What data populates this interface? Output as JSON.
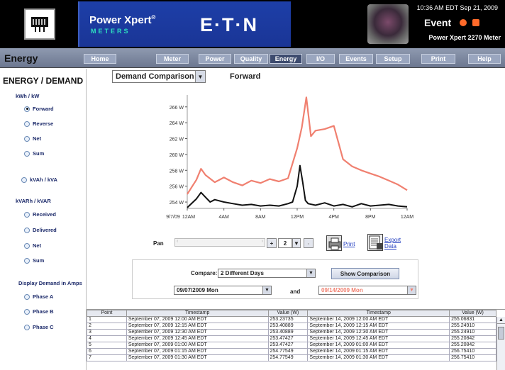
{
  "header": {
    "brand_title": "Power Xpert",
    "brand_reg": "®",
    "brand_sub": "METERS",
    "company": "E·T·N",
    "clock": "10:36 AM EDT  Sep 21, 2009",
    "event_label": "Event",
    "meter_name": "Power Xpert 2270 Meter"
  },
  "nav": {
    "section_title": "Energy",
    "tabs": [
      "Home",
      "Meter",
      "Power",
      "Quality",
      "Energy",
      "I/O",
      "Events",
      "Setup",
      "Print",
      "Help"
    ],
    "active_tab": "Energy"
  },
  "sidebar": {
    "title": "ENERGY / DEMAND",
    "kwh_label": "kWh / kW",
    "kwh_options": [
      "Forward",
      "Reverse",
      "Net",
      "Sum"
    ],
    "kwh_selected": "Forward",
    "kvah_option": "kVAh / kVA",
    "kvarh_label": "kVARh / kVAR",
    "kvarh_options": [
      "Received",
      "Delivered",
      "Net",
      "Sum"
    ],
    "amps_label": "Display Demand in Amps",
    "amps_options": [
      "Phase A",
      "Phase B",
      "Phase C"
    ]
  },
  "main": {
    "dropdown_value": "Demand Comparison",
    "direction": "Forward",
    "pan_label": "Pan",
    "zoom_value": "2",
    "print_label": "Print",
    "export_label_1": "Export",
    "export_label_2": "Data",
    "compare_label": "Compare:",
    "compare_value": "2 Different Days",
    "show_button": "Show Comparison",
    "day1_value": "09/07/2009 Mon",
    "and_label": "and",
    "day2_value": "09/14/2009 Mon"
  },
  "colors": {
    "series1": "#111111",
    "series2": "#f08070",
    "header_bg": "#000000",
    "brand_bg": "#1d3fa8",
    "nav_bg": "#7d88a1"
  },
  "chart_data": {
    "type": "line",
    "y_tick_labels": [
      "254 W",
      "256 W",
      "258 W",
      "260 W",
      "262 W",
      "264 W",
      "266 W"
    ],
    "ylim": [
      253.2,
      267.5
    ],
    "x_tick_labels": [
      "9/7/09\n12AM",
      "4AM",
      "8AM",
      "12PM",
      "4PM",
      "8PM",
      "12AM"
    ],
    "x_hours": [
      0,
      4,
      8,
      12,
      16,
      20,
      24
    ],
    "series": [
      {
        "color": "#111111",
        "x": [
          0,
          1,
          1.5,
          2,
          2.5,
          3,
          4,
          5,
          6,
          7,
          8,
          9,
          10,
          11,
          11.5,
          12,
          12.3,
          12.6,
          12.9,
          13.2,
          14,
          15,
          16,
          17,
          18,
          19,
          20,
          21,
          22,
          23,
          24
        ],
        "y": [
          253.3,
          254.4,
          255.2,
          254.6,
          254.0,
          254.3,
          254.0,
          253.8,
          253.6,
          253.7,
          253.5,
          253.6,
          253.5,
          253.8,
          254.0,
          256.0,
          258.6,
          256.5,
          254.2,
          253.8,
          253.6,
          253.9,
          253.5,
          253.7,
          253.4,
          253.8,
          253.5,
          253.6,
          253.7,
          253.5,
          253.4
        ]
      },
      {
        "color": "#f08070",
        "x": [
          0,
          1,
          1.5,
          2,
          3,
          4,
          5,
          6,
          7,
          8,
          9,
          10,
          11,
          12,
          12.5,
          13,
          13.5,
          14,
          15,
          16,
          17,
          18,
          19,
          20,
          21,
          22,
          23,
          24
        ],
        "y": [
          255.0,
          256.8,
          258.2,
          257.4,
          256.5,
          257.1,
          256.5,
          256.1,
          256.7,
          256.4,
          256.9,
          256.6,
          257.0,
          260.8,
          263.4,
          267.2,
          262.3,
          263.0,
          263.2,
          263.6,
          259.4,
          258.5,
          258.0,
          257.6,
          257.2,
          256.7,
          256.2,
          255.5
        ]
      }
    ]
  },
  "table": {
    "headers": [
      "Point",
      "Timestamp",
      "Value (W)",
      "Timestamp",
      "Value (W)"
    ],
    "rows": [
      [
        "1",
        "September 07, 2009 12:00 AM EDT",
        "253.23735",
        "September 14, 2009 12:00 AM EDT",
        "255.06831"
      ],
      [
        "2",
        "September 07, 2009 12:15 AM EDT",
        "253.40889",
        "September 14, 2009 12:15 AM EDT",
        "255.24910"
      ],
      [
        "3",
        "September 07, 2009 12:30 AM EDT",
        "253.40889",
        "September 14, 2009 12:30 AM EDT",
        "255.24910"
      ],
      [
        "4",
        "September 07, 2009 12:45 AM EDT",
        "253.47427",
        "September 14, 2009 12:45 AM EDT",
        "255.20842"
      ],
      [
        "5",
        "September 07, 2009 01:00 AM EDT",
        "253.47427",
        "September 14, 2009 01:00 AM EDT",
        "255.20842"
      ],
      [
        "6",
        "September 07, 2009 01:15 AM EDT",
        "254.77549",
        "September 14, 2009 01:15 AM EDT",
        "256.75410"
      ],
      [
        "7",
        "September 07, 2009 01:30 AM EDT",
        "254.77549",
        "September 14, 2009 01:30 AM EDT",
        "256.75410"
      ]
    ]
  }
}
